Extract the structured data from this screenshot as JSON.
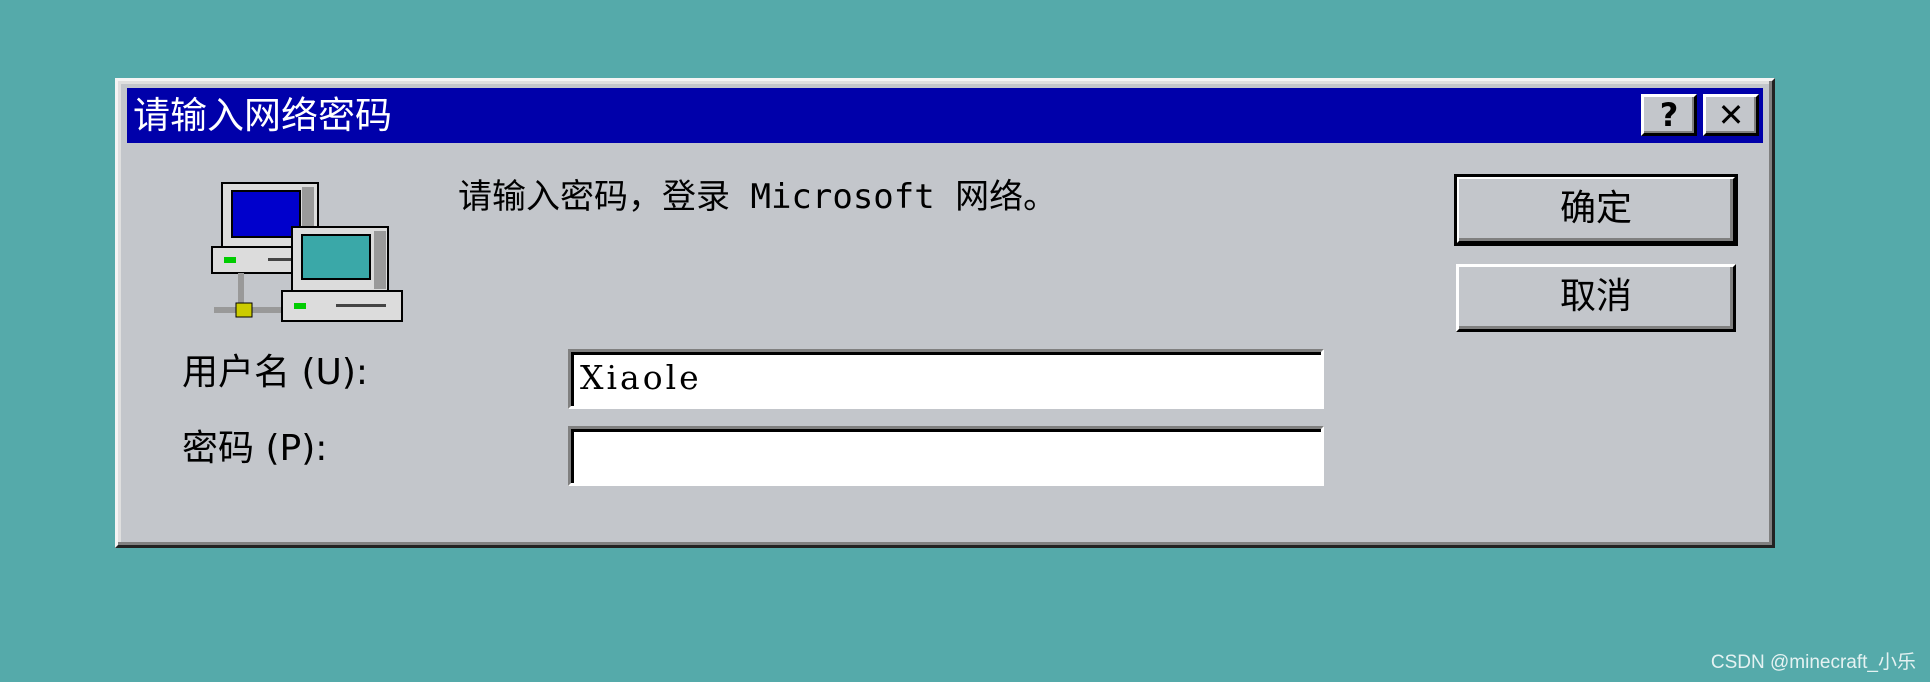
{
  "dialog": {
    "title": "请输入网络密码",
    "help_label": "?",
    "close_label": "✕",
    "prompt": "请输入密码，登录 Microsoft 网络。",
    "ok_label": "确定",
    "cancel_label": "取消",
    "username_label": "用户名 (U):",
    "username_value": "Xiaole",
    "password_label": "密码 (P):",
    "password_value": "",
    "icon": "network-computers-icon"
  },
  "watermark": "CSDN @minecraft_小乐",
  "colors": {
    "desktop": "#55aaaa",
    "titlebar": "#0000aa",
    "dialog_face": "#c3c6cb"
  }
}
